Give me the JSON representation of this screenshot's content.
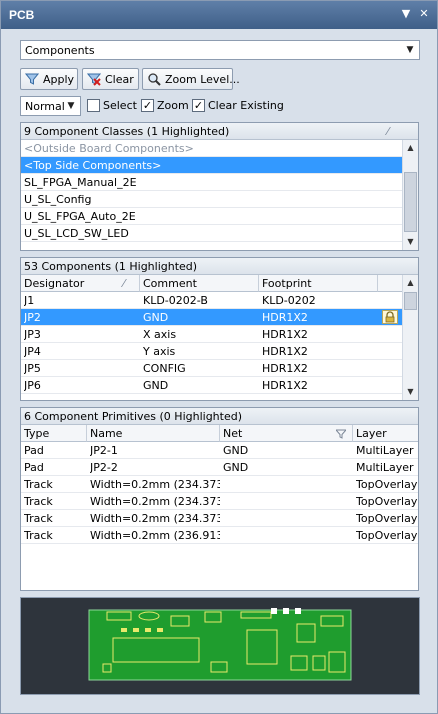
{
  "window": {
    "title": "PCB"
  },
  "filter": {
    "selected": "Components"
  },
  "toolbar": {
    "apply_label": "Apply",
    "clear_label": "Clear",
    "zoom_level_label": "Zoom Level...",
    "mode_selected": "Normal",
    "select_label": "Select",
    "select_checked": false,
    "zoom_label": "Zoom",
    "zoom_checked": true,
    "clear_existing_label": "Clear Existing",
    "clear_existing_checked": true
  },
  "classes": {
    "header": "9 Component Classes (1 Highlighted)",
    "items": [
      {
        "label": "<Outside Board Components>",
        "style": "dim"
      },
      {
        "label": "<Top Side Components>",
        "style": "selected"
      },
      {
        "label": "SL_FPGA_Manual_2E",
        "style": ""
      },
      {
        "label": "U_SL_Config",
        "style": ""
      },
      {
        "label": "U_SL_FPGA_Auto_2E",
        "style": ""
      },
      {
        "label": "U_SL_LCD_SW_LED",
        "style": ""
      }
    ]
  },
  "components": {
    "header": "53 Components (1 Highlighted)",
    "columns": [
      "Designator",
      "Comment",
      "Footprint"
    ],
    "rows": [
      {
        "designator": "J1",
        "comment": "KLD-0202-B",
        "footprint": "KLD-0202",
        "selected": false
      },
      {
        "designator": "JP2",
        "comment": "GND",
        "footprint": "HDR1X2",
        "selected": true,
        "locked": true
      },
      {
        "designator": "JP3",
        "comment": "X axis",
        "footprint": "HDR1X2",
        "selected": false
      },
      {
        "designator": "JP4",
        "comment": "Y axis",
        "footprint": "HDR1X2",
        "selected": false
      },
      {
        "designator": "JP5",
        "comment": "CONFIG",
        "footprint": "HDR1X2",
        "selected": false
      },
      {
        "designator": "JP6",
        "comment": "GND",
        "footprint": "HDR1X2",
        "selected": false
      }
    ]
  },
  "primitives": {
    "header": "6 Component Primitives (0 Highlighted)",
    "columns": [
      "Type",
      "Name",
      "Net",
      "Layer"
    ],
    "rows": [
      {
        "type": "Pad",
        "name": "JP2-1",
        "net": "GND",
        "layer": "MultiLayer"
      },
      {
        "type": "Pad",
        "name": "JP2-2",
        "net": "GND",
        "layer": "MultiLayer"
      },
      {
        "type": "Track",
        "name": "Width=0.2mm (234.373mi",
        "net": "",
        "layer": "TopOverlay"
      },
      {
        "type": "Track",
        "name": "Width=0.2mm (234.373mi",
        "net": "",
        "layer": "TopOverlay"
      },
      {
        "type": "Track",
        "name": "Width=0.2mm (234.373mi",
        "net": "",
        "layer": "TopOverlay"
      },
      {
        "type": "Track",
        "name": "Width=0.2mm (236.913mi",
        "net": "",
        "layer": "TopOverlay"
      }
    ]
  },
  "colors": {
    "selection": "#3399ff",
    "board": "#1f9d2e",
    "title_bar": "#4a6a94"
  }
}
